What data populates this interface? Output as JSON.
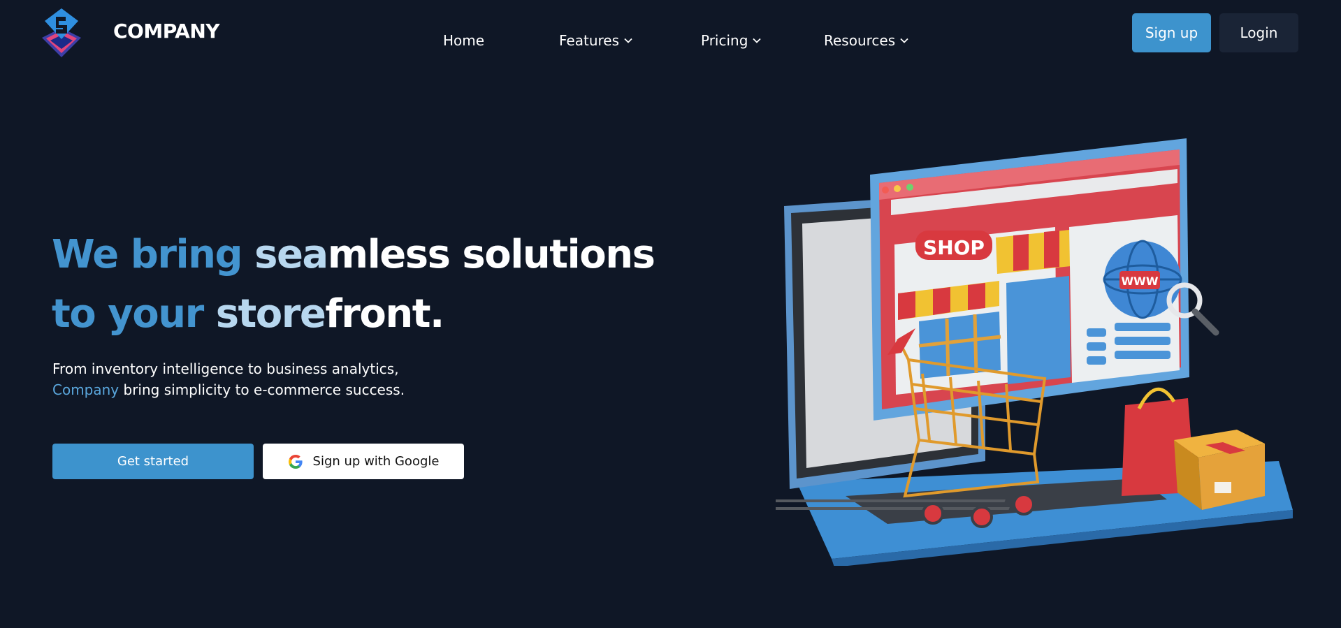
{
  "header": {
    "brand": "COMPANY",
    "nav": {
      "home": "Home",
      "features": "Features",
      "pricing": "Pricing",
      "resources": "Resources"
    },
    "signup_label": "Sign up",
    "login_label": "Login"
  },
  "hero": {
    "headline": {
      "part1": "We bring ",
      "part2": "sea",
      "part3": "mless solutions",
      "part4": "to your ",
      "part5": "store",
      "part6": "front."
    },
    "subtitle": {
      "line1": "From inventory intelligence to business analytics,",
      "brand": "Company",
      "line2_rest": " bring simplicity to e-commerce success."
    },
    "cta_primary": "Get started",
    "cta_google": "Sign up with Google",
    "illustration": {
      "shop_sign": "SHOP",
      "globe_label": "WWW"
    }
  },
  "colors": {
    "background": "#0f1726",
    "accent": "#3d93cd",
    "login_bg": "#1a2436"
  },
  "icons": {
    "logo": "diamond-logo-icon",
    "chevron": "chevron-down-icon",
    "google": "google-g-icon"
  }
}
